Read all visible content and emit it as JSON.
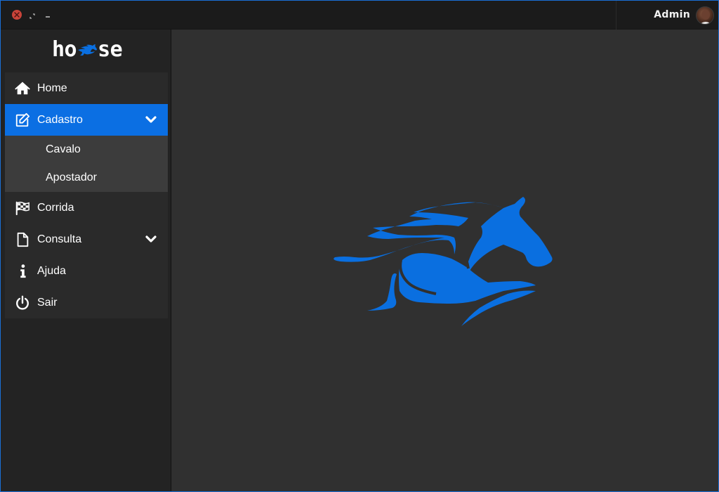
{
  "titlebar": {
    "user_name": "Admin"
  },
  "sidebar": {
    "logo_left": "ho",
    "logo_right": "se",
    "items": [
      {
        "label": "Home",
        "icon": "home-icon"
      },
      {
        "label": "Cadastro",
        "icon": "edit-icon",
        "expanded": true,
        "active": true
      },
      {
        "label": "Corrida",
        "icon": "checkered-flag-icon"
      },
      {
        "label": "Consulta",
        "icon": "file-icon",
        "expandable": true
      },
      {
        "label": "Ajuda",
        "icon": "info-icon"
      },
      {
        "label": "Sair",
        "icon": "power-icon"
      }
    ],
    "cadastro_sub": [
      {
        "label": "Cavalo"
      },
      {
        "label": "Apostador"
      }
    ]
  },
  "colors": {
    "accent": "#0b6fe3",
    "brand_blue": "#0a6fe0",
    "titlebar": "#1b1b1b",
    "sidebar": "#232323",
    "main": "#303030",
    "submenu": "#3c3c3c",
    "close_button": "#c9443a"
  }
}
